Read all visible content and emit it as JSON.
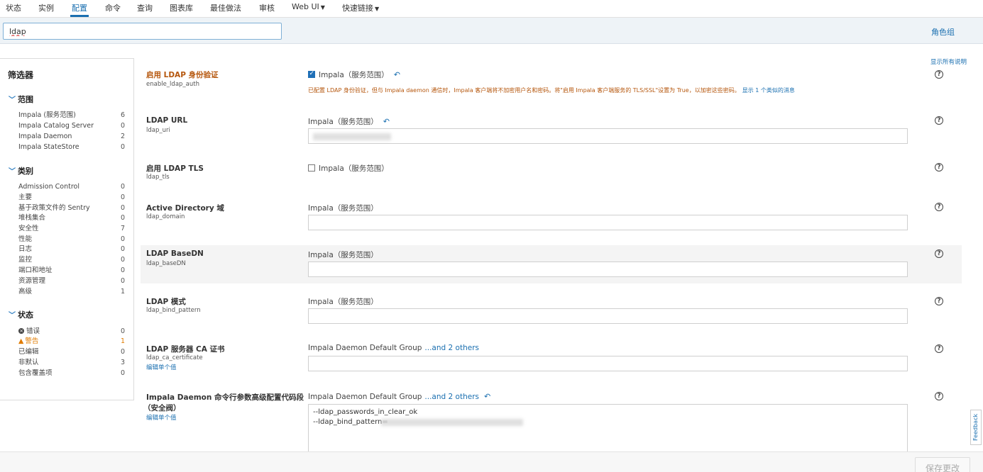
{
  "nav": {
    "tabs": [
      "状态",
      "实例",
      "配置",
      "命令",
      "查询",
      "图表库",
      "最佳做法",
      "审核",
      "Web UI",
      "快速链接"
    ],
    "active": "配置"
  },
  "search": {
    "value": "ldap"
  },
  "rolegroup_label": "角色组",
  "show_all_label": "显示所有说明",
  "filter": {
    "title": "筛选器",
    "sections": [
      {
        "label": "范围",
        "items": [
          {
            "label": "Impala (服务范围)",
            "count": "6"
          },
          {
            "label": "Impala Catalog Server",
            "count": "0"
          },
          {
            "label": "Impala Daemon",
            "count": "2"
          },
          {
            "label": "Impala StateStore",
            "count": "0"
          }
        ]
      },
      {
        "label": "类别",
        "items": [
          {
            "label": "Admission Control",
            "count": "0"
          },
          {
            "label": "主要",
            "count": "0"
          },
          {
            "label": "基于政策文件的 Sentry",
            "count": "0"
          },
          {
            "label": "堆栈集合",
            "count": "0"
          },
          {
            "label": "安全性",
            "count": "7"
          },
          {
            "label": "性能",
            "count": "0"
          },
          {
            "label": "日志",
            "count": "0"
          },
          {
            "label": "监控",
            "count": "0"
          },
          {
            "label": "端口和地址",
            "count": "0"
          },
          {
            "label": "资源管理",
            "count": "0"
          },
          {
            "label": "高级",
            "count": "1"
          }
        ]
      },
      {
        "label": "状态",
        "items": [
          {
            "label": "错误",
            "count": "0"
          },
          {
            "label": "警告",
            "count": "1"
          },
          {
            "label": "已编辑",
            "count": "0"
          },
          {
            "label": "非默认",
            "count": "3"
          },
          {
            "label": "包含覆盖项",
            "count": "0"
          }
        ]
      }
    ]
  },
  "props": [
    {
      "name": "启用 LDAP 身份验证",
      "key": "enable_ldap_auth",
      "scope": "Impala（服务范围）",
      "warning": "已配置 LDAP 身份验证，但与 Impala daemon 通信时，Impala 客户端将不加密用户名和密码。将\"启用 Impala 客户端服务的 TLS/SSL\"设置为 True，以加密这些密码。",
      "warning_link": "显示 1 个类似的消息"
    },
    {
      "name": "LDAP URL",
      "key": "ldap_uri",
      "scope": "Impala（服务范围）"
    },
    {
      "name": "启用 LDAP TLS",
      "key": "ldap_tls",
      "scope": "Impala（服务范围）"
    },
    {
      "name": "Active Directory 域",
      "key": "ldap_domain",
      "scope": "Impala（服务范围）"
    },
    {
      "name": "LDAP BaseDN",
      "key": "ldap_baseDN",
      "scope": "Impala（服务范围）"
    },
    {
      "name": "LDAP 模式",
      "key": "ldap_bind_pattern",
      "scope": "Impala（服务范围）"
    },
    {
      "name": "LDAP 服务器 CA 证书",
      "key": "ldap_ca_certificate",
      "edit": "编辑单个值",
      "scope": "Impala Daemon Default Group",
      "scope_link": "...and 2 others"
    },
    {
      "name": "Impala Daemon 命令行参数高级配置代码段",
      "name2": "（安全阀）",
      "edit": "编辑单个值",
      "scope": "Impala Daemon Default Group",
      "scope_link": "...and 2 others",
      "lines": [
        "--ldap_passwords_in_clear_ok",
        "--ldap_bind_pattern="
      ]
    }
  ],
  "help_glyph": "?",
  "save_label": "保存更改",
  "feedback_label": "Feedback",
  "icons": {
    "undo": "undo-arrow-icon",
    "help": "help-circle-icon",
    "chevron": "chevron-down-icon"
  },
  "colors": {
    "accent": "#1a6fb0",
    "warning": "#b5560c"
  }
}
